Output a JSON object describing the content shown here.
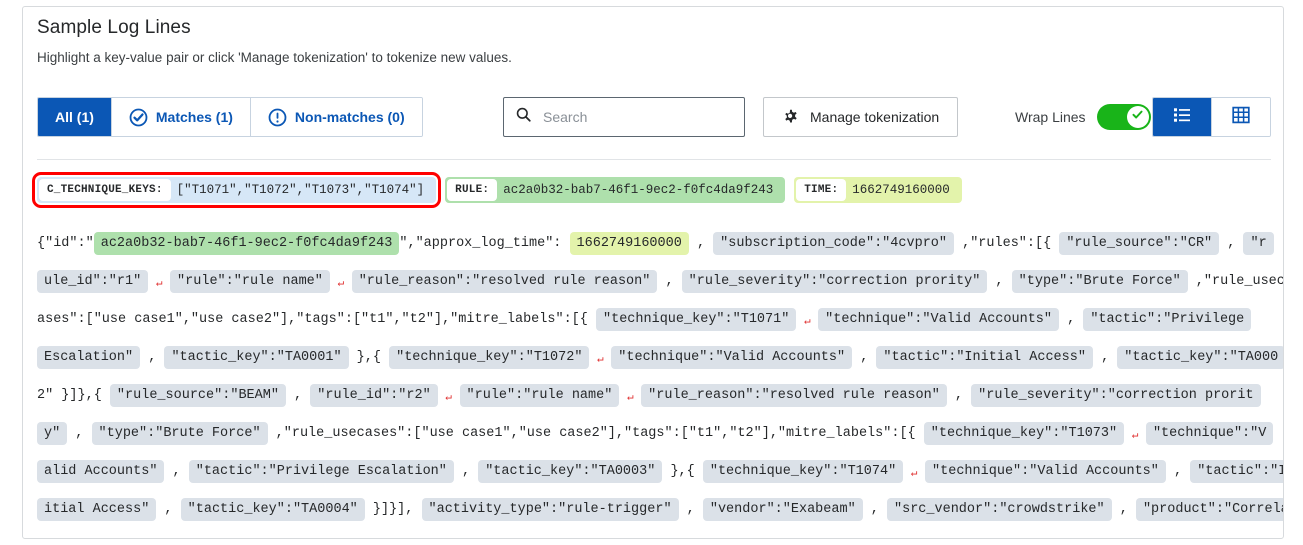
{
  "panel": {
    "title": "Sample Log Lines",
    "subtitle": "Highlight a key-value pair or click 'Manage tokenization' to tokenize new values."
  },
  "toolbar": {
    "tabs": [
      {
        "label": "All (1)",
        "icon": "none",
        "active": true
      },
      {
        "label": "Matches (1)",
        "icon": "check-circle-icon",
        "active": false
      },
      {
        "label": "Non-matches (0)",
        "icon": "exclamation-circle-icon",
        "active": false
      }
    ],
    "search": {
      "placeholder": "Search",
      "value": "",
      "icon": "search-icon"
    },
    "manage_tokenization": {
      "label": "Manage tokenization",
      "icon": "gear-icon"
    },
    "wrap_lines": {
      "label": "Wrap Lines",
      "enabled": true,
      "color": "#19b419"
    },
    "view_toggle": [
      {
        "name": "list-view",
        "icon": "list-icon",
        "active": true
      },
      {
        "name": "table-view",
        "icon": "grid-icon",
        "active": false
      }
    ]
  },
  "chips": [
    {
      "key": "C_TECHNIQUE_KEYS:",
      "value": "[\"T1071\",\"T1072\",\"T1073\",\"T1074\"]",
      "color": "blue",
      "selected": true
    },
    {
      "key": "RULE:",
      "value": "ac2a0b32-bab7-46f1-9ec2-f0fc4da9f243",
      "color": "green",
      "selected": false
    },
    {
      "key": "TIME:",
      "value": "1662749160000",
      "color": "lime",
      "selected": false
    }
  ],
  "log_lines": [
    [
      {
        "t": "plain",
        "s": "{\"id\":\""
      },
      {
        "t": "tok",
        "c": "green",
        "s": "ac2a0b32-bab7-46f1-9ec2-f0fc4da9f243"
      },
      {
        "t": "plain",
        "s": "\",\"approx_log_time\": "
      },
      {
        "t": "tok",
        "c": "lime",
        "s": "1662749160000"
      },
      {
        "t": "plain",
        "s": " , "
      },
      {
        "t": "tok",
        "c": "grey",
        "s": "\"subscription_code\":\"4cvpro\""
      },
      {
        "t": "plain",
        "s": " ,\"rules\":[{ "
      },
      {
        "t": "tok",
        "c": "grey",
        "s": "\"rule_source\":\"CR\""
      },
      {
        "t": "plain",
        "s": " , "
      },
      {
        "t": "tok",
        "c": "grey",
        "s": "\"r"
      }
    ],
    [
      {
        "t": "tok",
        "c": "grey",
        "s": "ule_id\":\"r1\""
      },
      {
        "t": "arrow"
      },
      {
        "t": "tok",
        "c": "grey",
        "s": "\"rule\":\"rule name\""
      },
      {
        "t": "arrow"
      },
      {
        "t": "tok",
        "c": "grey",
        "s": "\"rule_reason\":\"resolved rule reason\""
      },
      {
        "t": "plain",
        "s": " , "
      },
      {
        "t": "tok",
        "c": "grey",
        "s": "\"rule_severity\":\"correction prority\""
      },
      {
        "t": "plain",
        "s": " , "
      },
      {
        "t": "tok",
        "c": "grey",
        "s": "\"type\":\"Brute Force\""
      },
      {
        "t": "plain",
        "s": " ,\"rule_usec"
      }
    ],
    [
      {
        "t": "plain",
        "s": "ases\":[\"use case1\",\"use case2\"],\"tags\":[\"t1\",\"t2\"],\"mitre_labels\":[{ "
      },
      {
        "t": "tok",
        "c": "grey",
        "s": "\"technique_key\":\"T1071\""
      },
      {
        "t": "arrow"
      },
      {
        "t": "tok",
        "c": "grey",
        "s": "\"technique\":\"Valid Accounts\""
      },
      {
        "t": "plain",
        "s": " , "
      },
      {
        "t": "tok",
        "c": "grey",
        "s": "\"tactic\":\"Privilege"
      }
    ],
    [
      {
        "t": "tok",
        "c": "grey",
        "s": "Escalation\""
      },
      {
        "t": "plain",
        "s": " , "
      },
      {
        "t": "tok",
        "c": "grey",
        "s": "\"tactic_key\":\"TA0001\""
      },
      {
        "t": "plain",
        "s": " },{ "
      },
      {
        "t": "tok",
        "c": "grey",
        "s": "\"technique_key\":\"T1072\""
      },
      {
        "t": "arrow"
      },
      {
        "t": "tok",
        "c": "grey",
        "s": "\"technique\":\"Valid Accounts\""
      },
      {
        "t": "plain",
        "s": " , "
      },
      {
        "t": "tok",
        "c": "grey",
        "s": "\"tactic\":\"Initial Access\""
      },
      {
        "t": "plain",
        "s": " , "
      },
      {
        "t": "tok",
        "c": "grey",
        "s": "\"tactic_key\":\"TA000"
      }
    ],
    [
      {
        "t": "plain",
        "s": "2\" }]},"
      },
      {
        "t": "plain",
        "s": "{ "
      },
      {
        "t": "tok",
        "c": "grey",
        "s": "\"rule_source\":\"BEAM\""
      },
      {
        "t": "plain",
        "s": " , "
      },
      {
        "t": "tok",
        "c": "grey",
        "s": "\"rule_id\":\"r2\""
      },
      {
        "t": "arrow"
      },
      {
        "t": "tok",
        "c": "grey",
        "s": "\"rule\":\"rule name\""
      },
      {
        "t": "arrow"
      },
      {
        "t": "tok",
        "c": "grey",
        "s": "\"rule_reason\":\"resolved rule reason\""
      },
      {
        "t": "plain",
        "s": " , "
      },
      {
        "t": "tok",
        "c": "grey",
        "s": "\"rule_severity\":\"correction prorit"
      }
    ],
    [
      {
        "t": "tok",
        "c": "grey",
        "s": "y\""
      },
      {
        "t": "plain",
        "s": " , "
      },
      {
        "t": "tok",
        "c": "grey",
        "s": "\"type\":\"Brute Force\""
      },
      {
        "t": "plain",
        "s": " ,\"rule_usecases\":[\"use case1\",\"use case2\"],\"tags\":[\"t1\",\"t2\"],\"mitre_labels\":[{ "
      },
      {
        "t": "tok",
        "c": "grey",
        "s": "\"technique_key\":\"T1073\""
      },
      {
        "t": "arrow"
      },
      {
        "t": "tok",
        "c": "grey",
        "s": "\"technique\":\"V"
      }
    ],
    [
      {
        "t": "tok",
        "c": "grey",
        "s": "alid Accounts\""
      },
      {
        "t": "plain",
        "s": " , "
      },
      {
        "t": "tok",
        "c": "grey",
        "s": "\"tactic\":\"Privilege Escalation\""
      },
      {
        "t": "plain",
        "s": " , "
      },
      {
        "t": "tok",
        "c": "grey",
        "s": "\"tactic_key\":\"TA0003\""
      },
      {
        "t": "plain",
        "s": " },{ "
      },
      {
        "t": "tok",
        "c": "grey",
        "s": "\"technique_key\":\"T1074\""
      },
      {
        "t": "arrow"
      },
      {
        "t": "tok",
        "c": "grey",
        "s": "\"technique\":\"Valid Accounts\""
      },
      {
        "t": "plain",
        "s": " , "
      },
      {
        "t": "tok",
        "c": "grey",
        "s": "\"tactic\":\"In"
      }
    ],
    [
      {
        "t": "tok",
        "c": "grey",
        "s": "itial Access\""
      },
      {
        "t": "plain",
        "s": " , "
      },
      {
        "t": "tok",
        "c": "grey",
        "s": "\"tactic_key\":\"TA0004\""
      },
      {
        "t": "plain",
        "s": " }]}], "
      },
      {
        "t": "tok",
        "c": "grey",
        "s": "\"activity_type\":\"rule-trigger\""
      },
      {
        "t": "plain",
        "s": " , "
      },
      {
        "t": "tok",
        "c": "grey",
        "s": "\"vendor\":\"Exabeam\""
      },
      {
        "t": "plain",
        "s": " , "
      },
      {
        "t": "tok",
        "c": "grey",
        "s": "\"src_vendor\":\"crowdstrike\""
      },
      {
        "t": "plain",
        "s": " , "
      },
      {
        "t": "tok",
        "c": "grey",
        "s": "\"product\":\"Correlat"
      }
    ]
  ]
}
